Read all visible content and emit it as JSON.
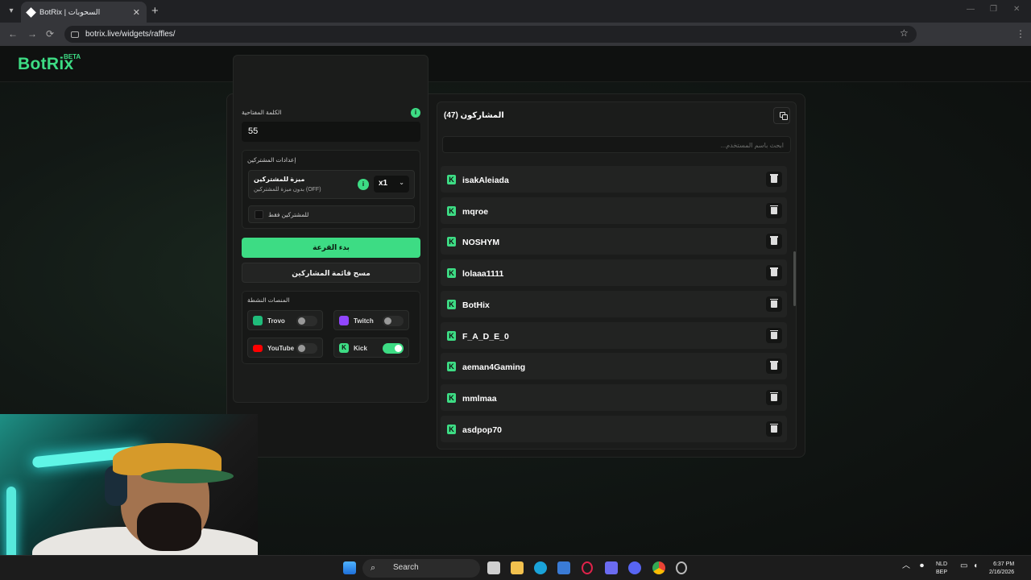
{
  "browser": {
    "tab_title": "BotRix | السحوبات",
    "tab_close": "✕",
    "new_tab": "+",
    "url": "botrix.live/widgets/raffles/",
    "nav_back": "←",
    "nav_forward": "→",
    "nav_reload": "⟳",
    "star": "☆",
    "menu": "⋮",
    "win_min": "—",
    "win_max": "❐",
    "win_close": "✕"
  },
  "site": {
    "logo": "BotRix",
    "beta": "BETA"
  },
  "settings": {
    "keyword_label": "الكلمة المفتاحية",
    "keyword_value": "55",
    "info_glyph": "i",
    "subscribers_section_label": "إعدادات المشتركين",
    "sub_bonus_title": "ميزة للمشتركين",
    "sub_bonus_desc": "بدون ميزة للمشتركين (OFF)",
    "multiplier_value": "x1",
    "chevron": "⌄",
    "subscribers_only_label": "للمشتركين فقط",
    "start_button": "بدء القرعة",
    "clear_button": "مسح قائمة المشاركين",
    "platforms_label": "المنصات النشطة",
    "platforms": [
      {
        "name": "Trovo",
        "enabled": false,
        "color": "#1fbc7a"
      },
      {
        "name": "Twitch",
        "enabled": false,
        "color": "#9146ff"
      },
      {
        "name": "YouTube",
        "enabled": false,
        "color": "#ff0000"
      },
      {
        "name": "Kick",
        "enabled": true,
        "color": "#3ddc84"
      }
    ]
  },
  "participants": {
    "title": "المشاركون (47)",
    "search_placeholder": "ابحث باسم المستخدم...",
    "platform_glyph": "K",
    "list": [
      "isakAleiada",
      "mqroe",
      "NOSHYM",
      "lolaaa1111",
      "BotHix",
      "F_A_D_E_0",
      "aeman4Gaming",
      "mmlmaa",
      "asdpop70"
    ]
  },
  "taskbar": {
    "search": "Search",
    "lang_top": "NLD",
    "lang_bottom": "BEP",
    "time": "6:37 PM",
    "date": "2/16/2026"
  },
  "colors": {
    "accent": "#3ddc84",
    "panel": "#1b1c1b",
    "background": "#111211"
  }
}
